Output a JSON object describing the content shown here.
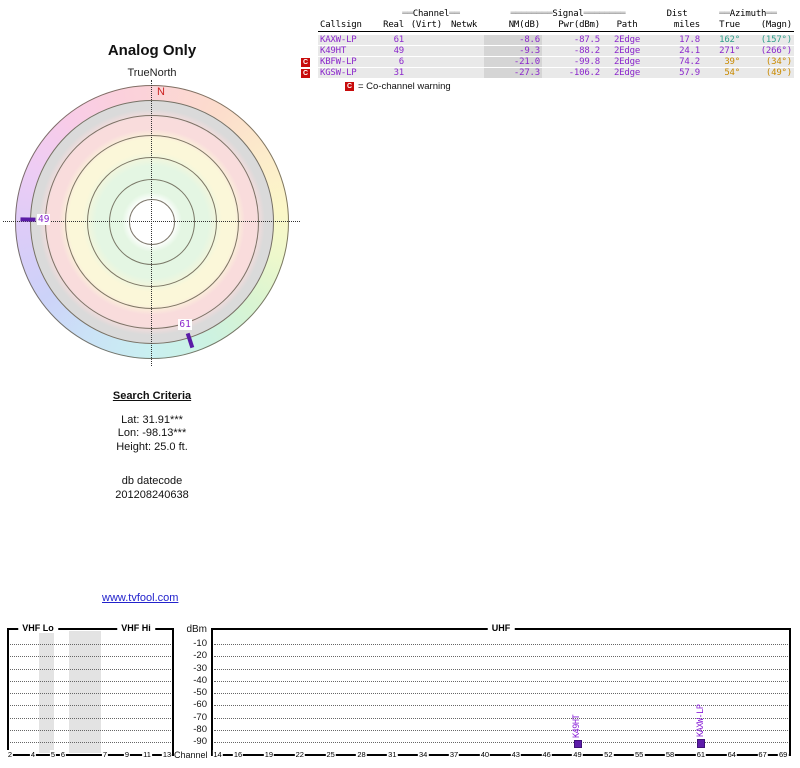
{
  "radar": {
    "title": "Analog Only",
    "north_label": "TrueNorth",
    "n_marker": "N",
    "markers": [
      {
        "label": "49",
        "azimuth_deg": 271
      },
      {
        "label": "61",
        "azimuth_deg": 162
      }
    ]
  },
  "table": {
    "group_headers": {
      "channel": "Channel",
      "signal": "Signal",
      "dist": "Dist",
      "azimuth": "Azimuth"
    },
    "col_headers": [
      "Callsign",
      "Real",
      "(Virt)",
      "Netwk",
      "NM(dB)",
      "Pwr(dBm)",
      "Path",
      "miles",
      "True",
      "(Magn)"
    ],
    "rows": [
      {
        "co_channel": false,
        "callsign": "KAXW-LP",
        "real": "61",
        "virt": "",
        "netwk": "",
        "nm": "-8.6",
        "pwr": "-87.5",
        "path": "2Edge",
        "miles": "17.8",
        "true": "162°",
        "magn": "(157°)",
        "azimuth_color": "#2f9e8a"
      },
      {
        "co_channel": false,
        "callsign": "K49HT",
        "real": "49",
        "virt": "",
        "netwk": "",
        "nm": "-9.3",
        "pwr": "-88.2",
        "path": "2Edge",
        "miles": "24.1",
        "true": "271°",
        "magn": "(266°)",
        "azimuth_color": "#8b27cc"
      },
      {
        "co_channel": true,
        "callsign": "KBFW-LP",
        "real": "6",
        "virt": "",
        "netwk": "",
        "nm": "-21.0",
        "pwr": "-99.8",
        "path": "2Edge",
        "miles": "74.2",
        "true": "39°",
        "magn": "(34°)",
        "azimuth_color": "#c98a00"
      },
      {
        "co_channel": true,
        "callsign": "KGSW-LP",
        "real": "31",
        "virt": "",
        "netwk": "",
        "nm": "-27.3",
        "pwr": "-106.2",
        "path": "2Edge",
        "miles": "57.9",
        "true": "54°",
        "magn": "(49°)",
        "azimuth_color": "#c98a00"
      }
    ],
    "legend": {
      "symbol": "C",
      "text": "= Co-channel warning"
    }
  },
  "search": {
    "heading": "Search Criteria",
    "lat": "Lat: 31.91***",
    "lon": "Lon: -98.13***",
    "height": "Height: 25.0 ft.",
    "datecode_label": "db datecode",
    "datecode": "201208240638"
  },
  "link": {
    "text": "www.tvfool.com"
  },
  "chart": {
    "dbm_label": "dBm",
    "channel_label": "Channel",
    "band_labels": {
      "vhf_lo": "VHF Lo",
      "vhf_hi": "VHF Hi",
      "uhf": "UHF"
    },
    "y_ticks": [
      -10,
      -20,
      -30,
      -40,
      -50,
      -60,
      -70,
      -80,
      -90
    ],
    "vhf_ticks": [
      2,
      4,
      5,
      6,
      7,
      9,
      11,
      13
    ],
    "uhf_ticks": [
      14,
      16,
      19,
      22,
      25,
      28,
      31,
      34,
      37,
      40,
      43,
      46,
      49,
      52,
      55,
      58,
      61,
      64,
      67,
      69
    ],
    "bars": [
      {
        "callsign": "K49HT",
        "channel": 49,
        "pwr_dbm": -88.2
      },
      {
        "callsign": "KAXW-LP",
        "channel": 61,
        "pwr_dbm": -87.5
      }
    ]
  },
  "colors": {
    "value_purple": "#8b27cc",
    "marker_purple": "#5a1ba6",
    "co_channel_red": "#c80b0b",
    "north_red": "#cc2222",
    "link_blue": "#2222cc"
  },
  "chart_data": [
    {
      "type": "scatter",
      "variant": "polar-azimuth-radar",
      "title": "Analog Only",
      "orientation_label": "TrueNorth",
      "rings": "concentric signal-strength zones (white center, green, yellow, pink, gray, rainbow azimuth wheel outermost)",
      "points": [
        {
          "channel": 49,
          "callsign": "K49HT",
          "azimuth_true_deg": 271
        },
        {
          "channel": 61,
          "callsign": "KAXW-LP",
          "azimuth_true_deg": 162
        }
      ]
    },
    {
      "type": "bar",
      "title": "Channel vs signal power",
      "xlabel": "Channel",
      "ylabel": "dBm",
      "ylim": [
        -98,
        0
      ],
      "x_bands": [
        "VHF Lo",
        "VHF Hi",
        "UHF"
      ],
      "categories": [
        49,
        61
      ],
      "series": [
        {
          "name": "Pwr(dBm)",
          "values": [
            -88.2,
            -87.5
          ],
          "labels": [
            "K49HT",
            "KAXW-LP"
          ]
        }
      ],
      "grid": "dotted horizontal every 10 dBm",
      "spectrum_gap_bands": [
        "between ch4 and ch5",
        "between ch6 and ch7 (FM)"
      ]
    },
    {
      "type": "table",
      "title": "Station list",
      "columns": [
        "Callsign",
        "Real",
        "(Virt)",
        "Netwk",
        "NM(dB)",
        "Pwr(dBm)",
        "Path",
        "miles",
        "True",
        "(Magn)"
      ],
      "rows": [
        [
          "KAXW-LP",
          61,
          "",
          "",
          -8.6,
          -87.5,
          "2Edge",
          17.8,
          "162°",
          "(157°)"
        ],
        [
          "K49HT",
          49,
          "",
          "",
          -9.3,
          -88.2,
          "2Edge",
          24.1,
          "271°",
          "(266°)"
        ],
        [
          "KBFW-LP",
          6,
          "",
          "",
          -21.0,
          -99.8,
          "2Edge",
          74.2,
          "39°",
          "(34°)"
        ],
        [
          "KGSW-LP",
          31,
          "",
          "",
          -27.3,
          -106.2,
          "2Edge",
          57.9,
          "54°",
          "(49°)"
        ]
      ]
    }
  ]
}
